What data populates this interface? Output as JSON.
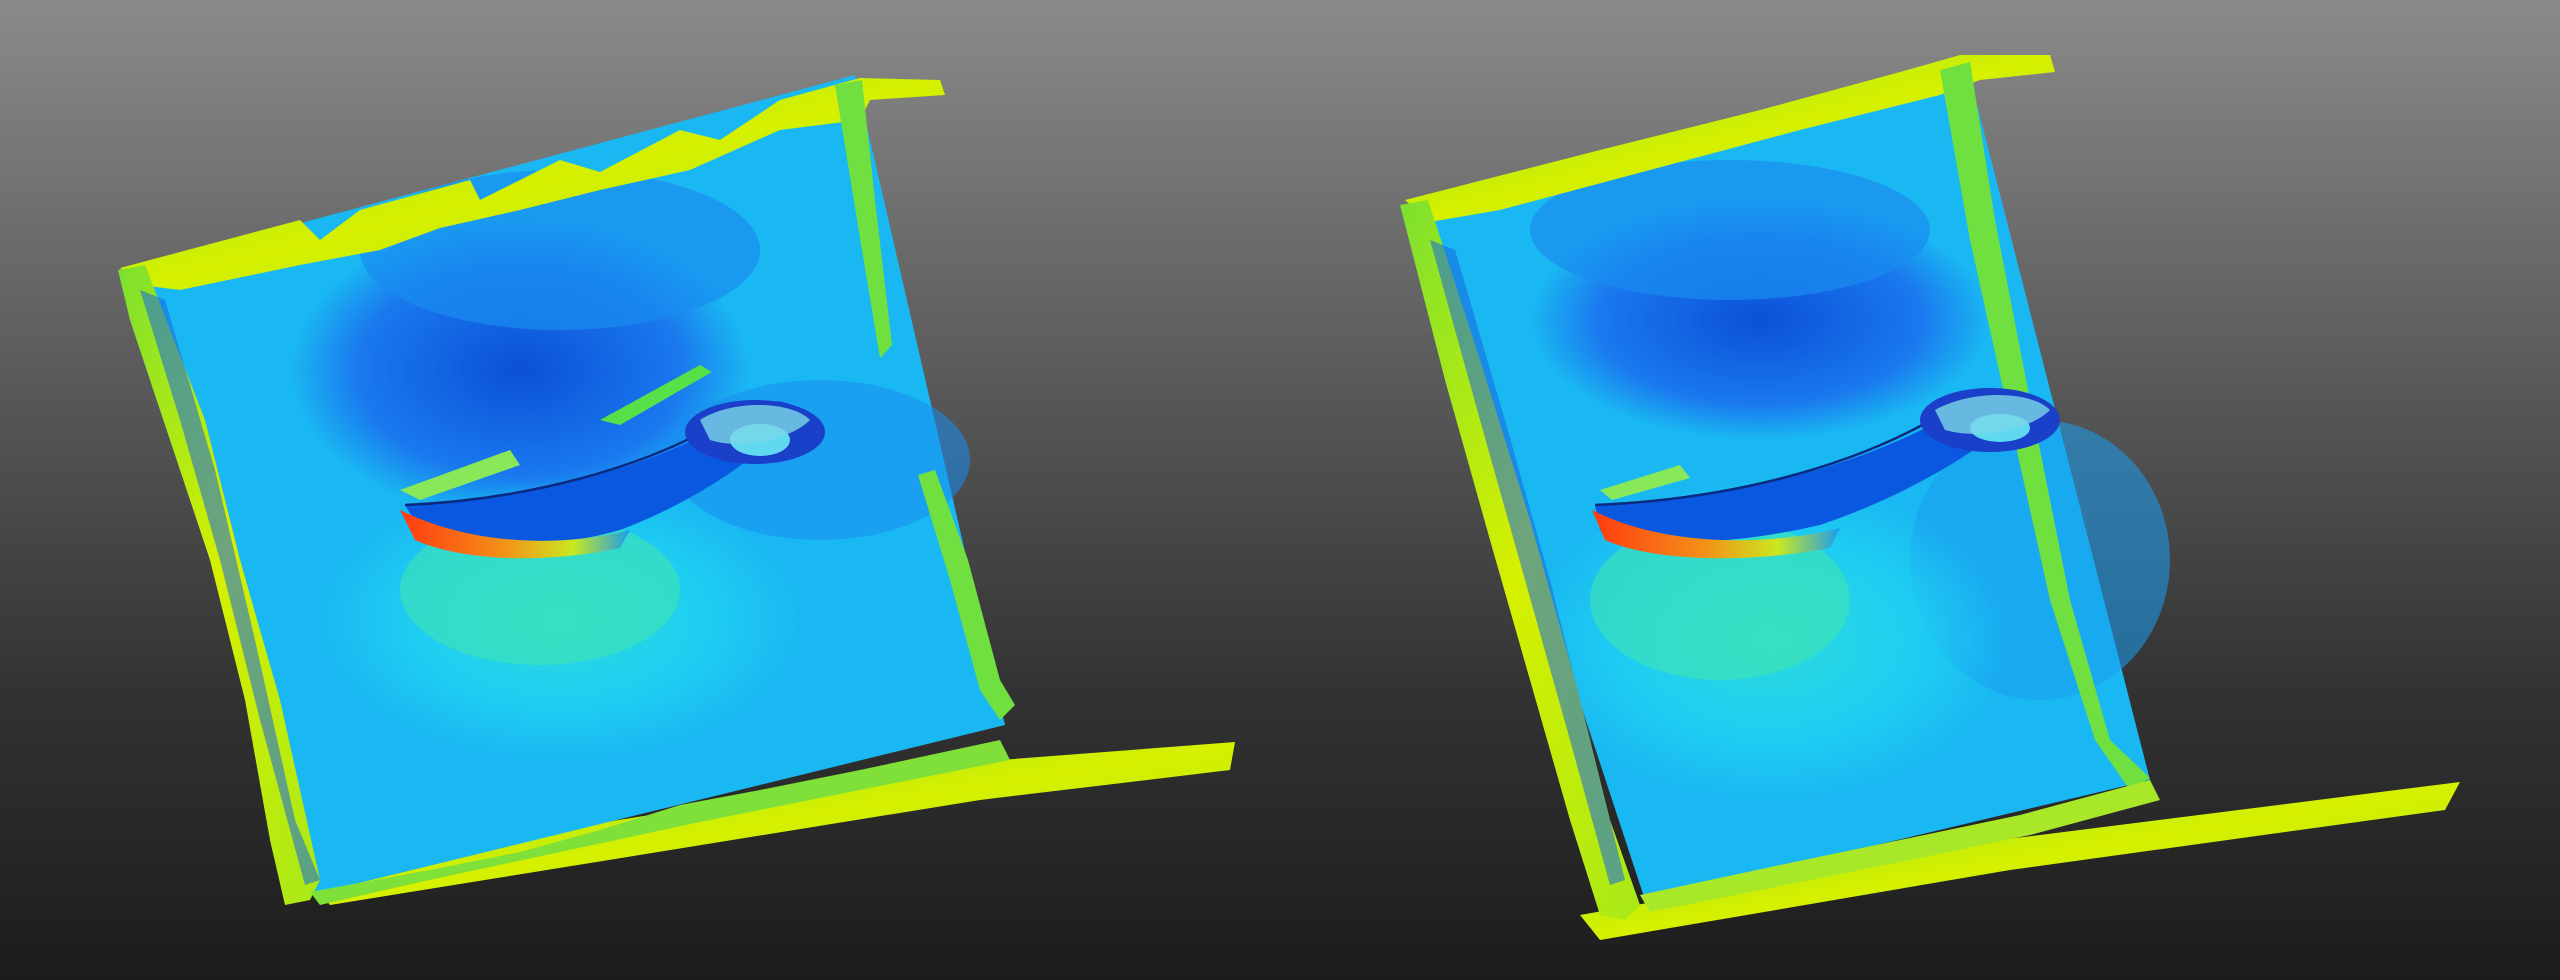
{
  "views": [
    {
      "id": "left-view"
    },
    {
      "id": "right-view"
    }
  ],
  "colors": {
    "background_top": "#8a8a8a",
    "background_bottom": "#1c1c1c",
    "contour_low": "#0a4fd8",
    "contour_mid": "#18c8f0",
    "contour_green": "#28e060",
    "contour_yellow": "#c8f000",
    "contour_high": "#f04010"
  }
}
